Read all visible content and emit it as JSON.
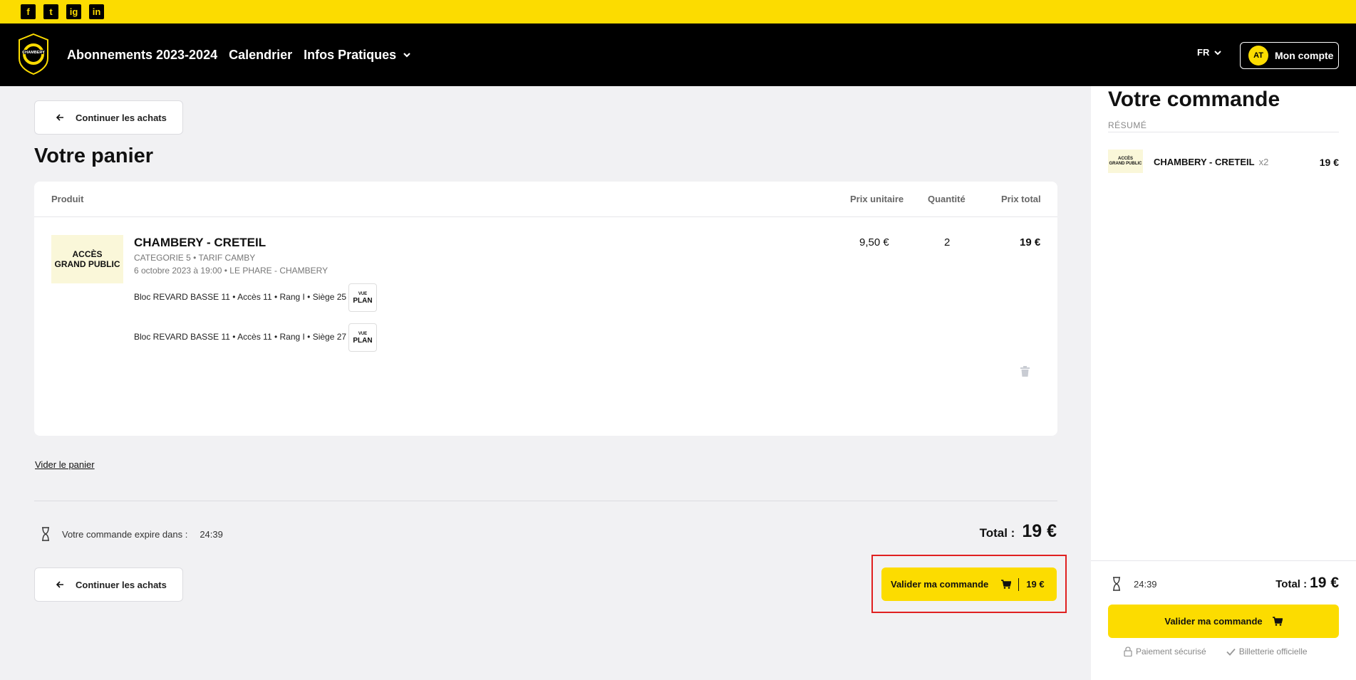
{
  "social": {
    "facebook": "f",
    "twitter": "t",
    "instagram": "ig",
    "linkedin": "in"
  },
  "header": {
    "logo_text": "CHAMBERY",
    "nav": [
      "Abonnements 2023-2024",
      "Calendrier",
      "Infos Pratiques"
    ],
    "lang": "FR",
    "avatar": "AT",
    "account": "Mon compte"
  },
  "main": {
    "back_label": "Continuer les achats",
    "title": "Votre panier",
    "columns": {
      "product": "Produit",
      "unit_price": "Prix unitaire",
      "quantity": "Quantité",
      "total_price": "Prix total"
    },
    "item": {
      "thumb_line1": "ACCÈS",
      "thumb_line2": "GRAND PUBLIC",
      "name": "CHAMBERY - CRETEIL",
      "category": "CATEGORIE 5 • TARIF CAMBY",
      "date_place": "6 octobre 2023 à 19:00 • LE PHARE - CHAMBERY",
      "seats": [
        "Bloc REVARD BASSE 11 • Accès 11 • Rang I • Siège 25",
        "Bloc REVARD BASSE 11 • Accès 11 • Rang I • Siège 27"
      ],
      "plan_small": "VUE",
      "plan_big": "PLAN",
      "unit_price": "9,50 €",
      "quantity": "2",
      "total": "19 €"
    },
    "empty_cart": "Vider le panier",
    "expire_label": "Votre commande expire dans :",
    "expire_time": "24:39",
    "total_label": "Total :",
    "total_value": "19 €",
    "validate_label": "Valider ma commande",
    "validate_price": "19 €"
  },
  "sidebar": {
    "title": "Votre commande",
    "subtitle": "RÉSUMÉ",
    "thumb_line1": "ACCÈS",
    "thumb_line2": "GRAND PUBLIC",
    "item_name": "CHAMBERY - CRETEIL",
    "item_qty": "x2",
    "item_price": "19 €",
    "timer": "24:39",
    "total_label": "Total :",
    "total_value": "19 €",
    "validate_label": "Valider ma commande",
    "secure": "Paiement sécurisé",
    "official": "Billetterie officielle"
  },
  "colors": {
    "brand_yellow": "#fcdc00",
    "header_black": "#000000",
    "highlight_red": "#e02020"
  }
}
